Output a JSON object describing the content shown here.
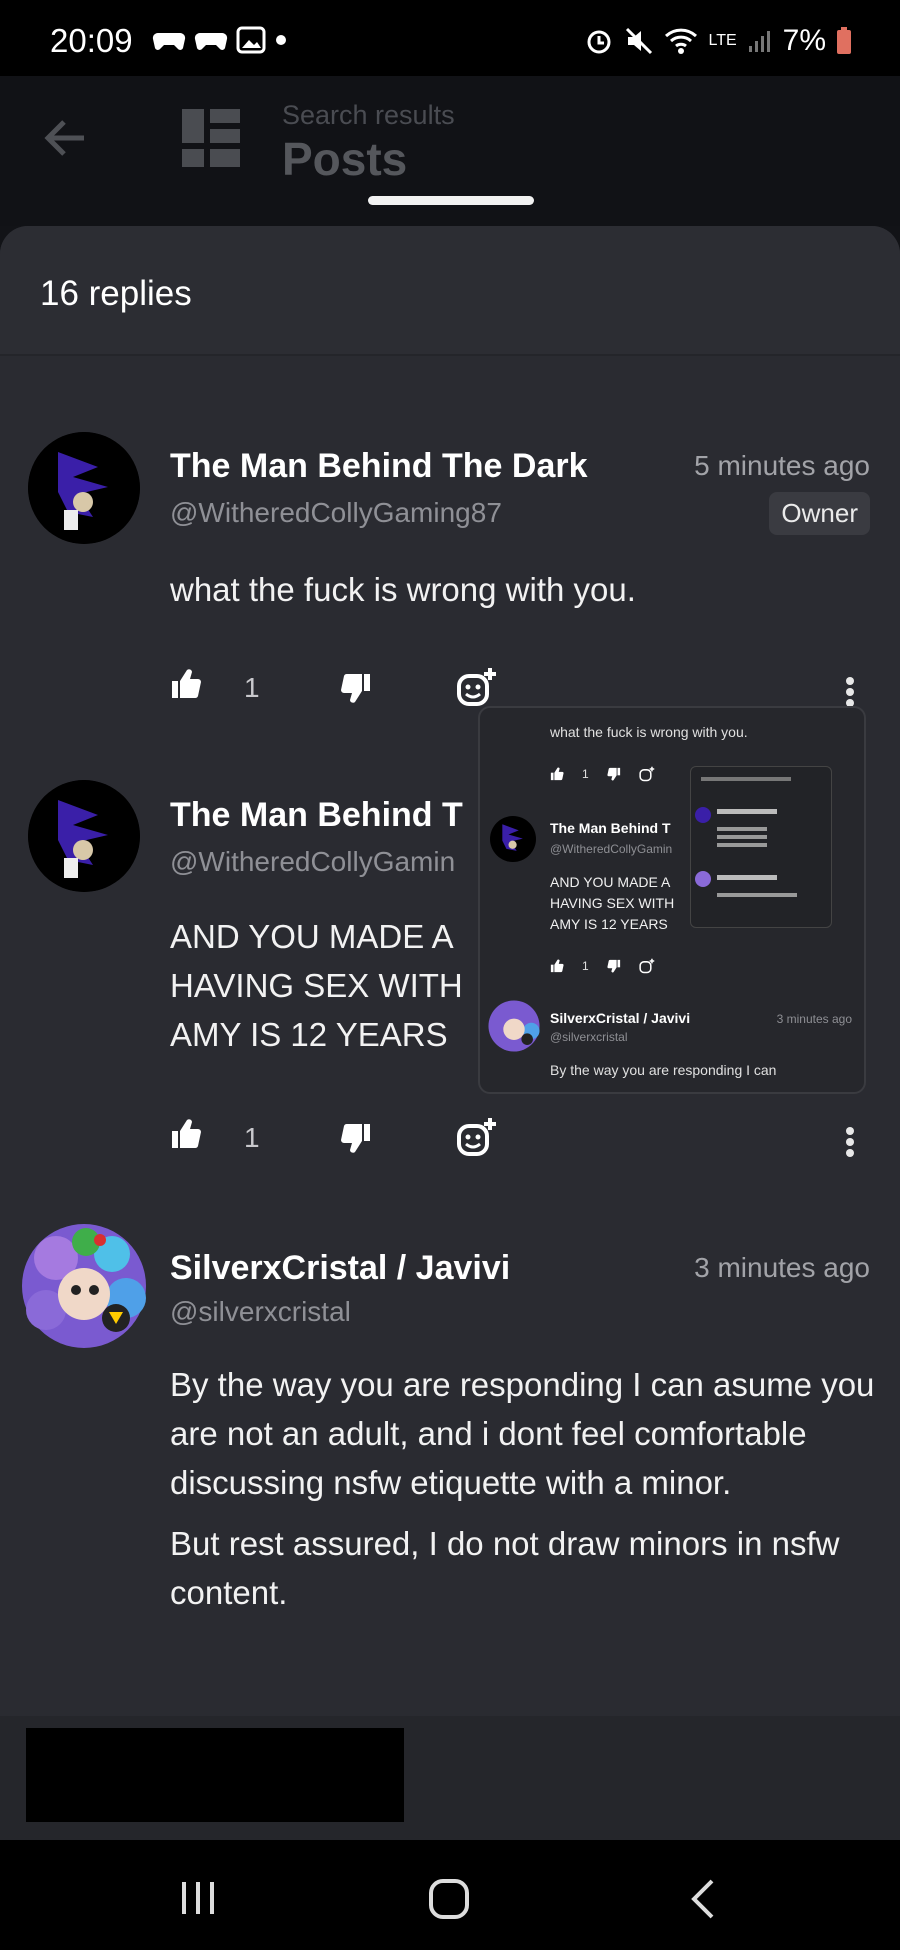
{
  "status_bar": {
    "time": "20:09",
    "battery": "7%",
    "network": "LTE"
  },
  "header": {
    "subtitle": "Search results",
    "title": "Posts"
  },
  "sheet": {
    "replies_title": "16 replies"
  },
  "comments": [
    {
      "name": "The Man Behind The Dark",
      "handle": "@WitheredCollyGaming87",
      "time": "5 minutes ago",
      "badge": "Owner",
      "body": "what the fuck is wrong with you.",
      "likes": "1"
    },
    {
      "name": "The Man Behind T",
      "handle": "@WitheredCollyGamin",
      "body_lines": [
        "AND YOU MADE A",
        "HAVING SEX WITH",
        "AMY IS 12 YEARS"
      ],
      "likes": "1"
    },
    {
      "name": "SilverxCristal / Javivi",
      "handle": "@silverxcristal",
      "time": "3 minutes ago",
      "paragraphs": [
        "By the way you are responding I can asume you are not an adult, and i dont feel comfortable discussing nsfw etiquette with a minor.",
        "But rest assured, I do not draw minors in nsfw content."
      ]
    }
  ],
  "preview": {
    "top_text": "what the fuck is wrong with you.",
    "like_count": "1",
    "c2_name": "The Man Behind T",
    "c2_handle": "@WitheredCollyGamin",
    "c2_lines": [
      "AND YOU MADE A",
      "HAVING SEX WITH",
      "AMY IS 12 YEARS"
    ],
    "c2_likes": "1",
    "c3_name": "SilverxCristal / Javivi",
    "c3_handle": "@silverxcristal",
    "c3_time": "3 minutes ago",
    "c3_body": "By the way you are responding I can"
  },
  "colors": {
    "sheet_bg": "#2a2b31",
    "page_bg": "#121317",
    "text": "#f2f2f2",
    "muted": "#8f9096"
  }
}
